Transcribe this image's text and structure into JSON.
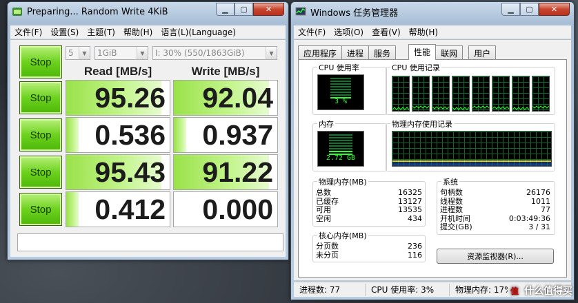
{
  "cdm": {
    "title": "Preparing... Random Write 4KiB",
    "menu": [
      "文件(F)",
      "设置(S)",
      "主题(T)",
      "帮助(H)",
      "语言(L)(Language)"
    ],
    "count_select": "5",
    "size_select": "1GiB",
    "drive_select": "I: 30% (550/1863GiB)",
    "all_button": "Stop",
    "read_header": "Read [MB/s]",
    "write_header": "Write [MB/s]",
    "rows": [
      {
        "button": "Stop",
        "read": "95.26",
        "write": "92.04",
        "read_fill": 0.92,
        "write_fill": 0.92
      },
      {
        "button": "Stop",
        "read": "0.536",
        "write": "0.937",
        "read_fill": 0.12,
        "write_fill": 0.12
      },
      {
        "button": "Stop",
        "read": "95.43",
        "write": "91.22",
        "read_fill": 0.92,
        "write_fill": 0.92
      },
      {
        "button": "Stop",
        "read": "0.412",
        "write": "0.000",
        "read_fill": 0.12,
        "write_fill": 0
      }
    ],
    "status_text": ""
  },
  "taskman": {
    "title": "Windows 任务管理器",
    "menu": [
      "文件(F)",
      "选项(O)",
      "查看(V)",
      "帮助(H)"
    ],
    "tabs": [
      "应用程序",
      "进程",
      "服务",
      "性能",
      "联网",
      "用户"
    ],
    "active_tab": "性能",
    "cpu_usage_title": "CPU 使用率",
    "cpu_usage_value": "3 %",
    "cpu_history_title": "CPU 使用记录",
    "mem_title": "内存",
    "mem_value": "2.72 GB",
    "mem_history_title": "物理内存使用记录",
    "physical_memory": {
      "title": "物理内存(MB)",
      "rows": [
        {
          "label": "总数",
          "value": "16325"
        },
        {
          "label": "已缓存",
          "value": "13127"
        },
        {
          "label": "可用",
          "value": "13535"
        },
        {
          "label": "空闲",
          "value": "434"
        }
      ]
    },
    "kernel_memory": {
      "title": "核心内存(MB)",
      "rows": [
        {
          "label": "分页数",
          "value": "236"
        },
        {
          "label": "未分页",
          "value": "116"
        }
      ]
    },
    "system": {
      "title": "系统",
      "rows": [
        {
          "label": "句柄数",
          "value": "26176"
        },
        {
          "label": "线程数",
          "value": "1011"
        },
        {
          "label": "进程数",
          "value": "77"
        },
        {
          "label": "开机时间",
          "value": "0:03:49:36"
        },
        {
          "label": "提交(GB)",
          "value": "3 / 31"
        }
      ]
    },
    "resource_monitor_button": "资源监视器(R)...",
    "status": {
      "processes": "进程数: 77",
      "cpu": "CPU 使用率: 3%",
      "memory": "物理内存: 17%"
    }
  },
  "watermark": "值 什么值得买",
  "colors": {
    "stop_green": "#6cd21e",
    "graph_green": "#2eff2e",
    "graph_grid": "#0b6b2f",
    "mem_line": "#ffff00"
  }
}
